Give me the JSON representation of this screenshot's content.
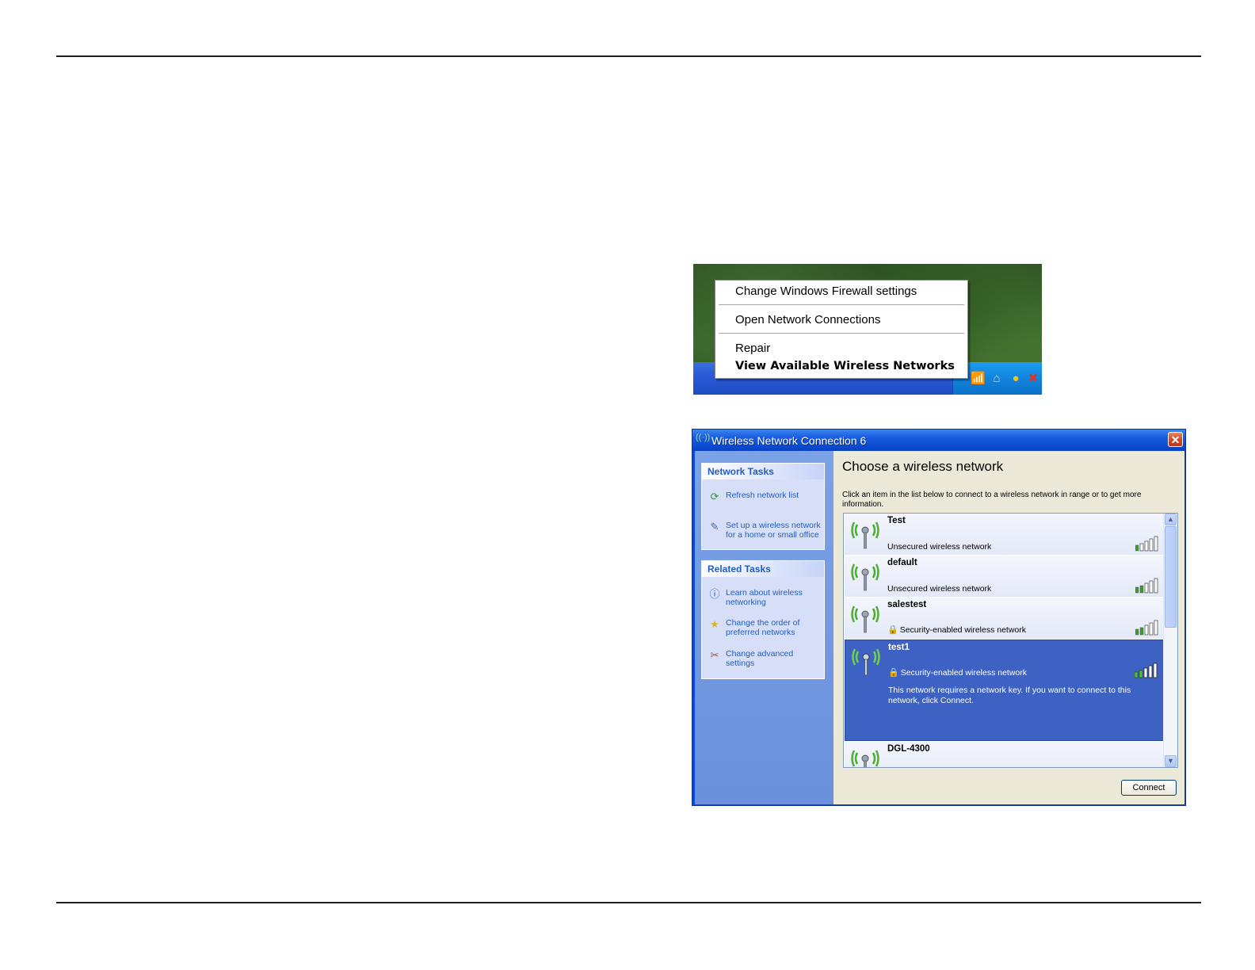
{
  "context_menu": {
    "items": [
      {
        "label": "Change Windows Firewall settings"
      },
      {
        "label": "Open Network Connections"
      },
      {
        "label": "Repair"
      },
      {
        "label": "View Available Wireless Networks"
      }
    ],
    "tray_icons": [
      "wireless-disconnected-icon",
      "home-network-icon",
      "security-alert-icon",
      "network-disconnected-icon"
    ]
  },
  "dialog": {
    "title": "Wireless Network Connection 6",
    "close_label": "✕",
    "network_tasks": {
      "header": "Network Tasks",
      "items": [
        {
          "label": "Refresh network list",
          "icon": "refresh-icon"
        },
        {
          "label": "Set up a wireless network for a home or small office",
          "icon": "setup-network-icon"
        }
      ]
    },
    "related_tasks": {
      "header": "Related Tasks",
      "items": [
        {
          "label": "Learn about wireless networking",
          "icon": "info-icon"
        },
        {
          "label": "Change the order of preferred networks",
          "icon": "star-icon"
        },
        {
          "label": "Change advanced settings",
          "icon": "wrench-icon"
        }
      ]
    },
    "heading": "Choose a wireless network",
    "description": "Click an item in the list below to connect to a wireless network in range or to get more information.",
    "networks": [
      {
        "name": "Test",
        "status": "Unsecured wireless network",
        "signal_bars": 5
      },
      {
        "name": "default",
        "status": "Unsecured wireless network",
        "signal_bars": 5
      },
      {
        "name": "salestest",
        "status": "Security-enabled wireless network",
        "signal_bars": 5
      },
      {
        "name": "test1",
        "status": "Security-enabled wireless network",
        "note": "This network requires a network key. If you want to connect to this network, click Connect.",
        "signal_bars": 5
      },
      {
        "name": "DGL-4300"
      }
    ],
    "connect_label": "Connect",
    "colors": {
      "title_bar": "#0a4ad0",
      "selected_row": "#3d62c4",
      "task_link": "#215dc6",
      "dialog_body": "#ece9d8"
    }
  }
}
